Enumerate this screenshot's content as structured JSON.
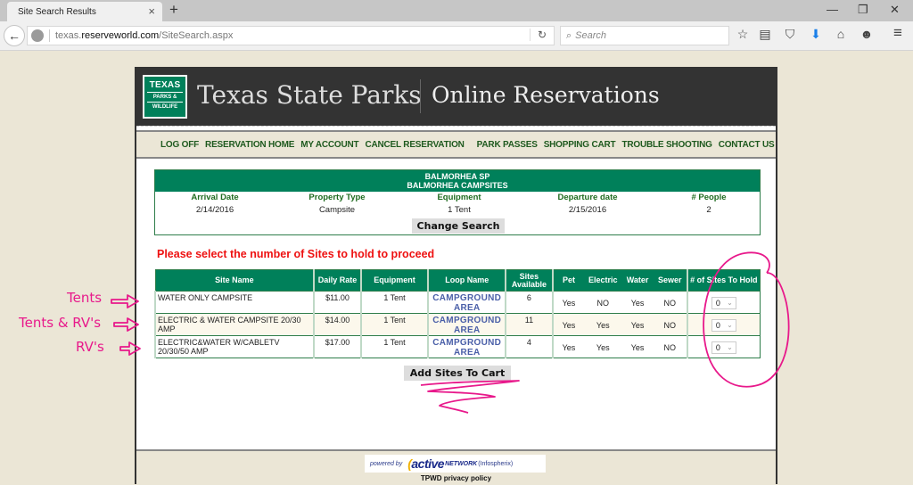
{
  "browser": {
    "tab_title": "Site Search Results",
    "tab_close": "×",
    "new_tab": "+",
    "url_prefix": "texas.",
    "url_host": "reserveworld.com",
    "url_path": "/SiteSearch.aspx",
    "search_placeholder": "Search",
    "window_controls": {
      "minimize": "—",
      "restore": "❐",
      "close": "✕"
    },
    "toolbar_icons": [
      "star-icon",
      "reading-list-icon",
      "pocket-icon",
      "download-icon",
      "home-icon",
      "hello-icon",
      "menu-icon"
    ],
    "icons": {
      "back": "←",
      "reload": "↻",
      "search": "🔍",
      "star": "☆",
      "reading_list": "▤",
      "pocket": "⛉",
      "download": "⬇",
      "home": "⌂",
      "hello": "☻",
      "menu": "≡"
    },
    "download_color": "#1a7fe8"
  },
  "header": {
    "logo": {
      "line1": "TEXAS",
      "line2": "PARKS &",
      "line3": "WILDLIFE"
    },
    "title": "Texas State Parks",
    "subtitle": "Online Reservations",
    "brand_color": "#00805a"
  },
  "menu": {
    "items": [
      "LOG OFF",
      "RESERVATION HOME",
      "MY ACCOUNT",
      "CANCEL RESERVATION",
      "PARK PASSES",
      "SHOPPING CART",
      "TROUBLE SHOOTING",
      "CONTACT US"
    ]
  },
  "summary": {
    "park": "BALMORHEA SP",
    "area": "BALMORHEA CAMPSITES",
    "fields": [
      {
        "label": "Arrival Date",
        "value": "2/14/2016"
      },
      {
        "label": "Property Type",
        "value": "Campsite"
      },
      {
        "label": "Equipment",
        "value": "1 Tent"
      },
      {
        "label": "Departure date",
        "value": "2/15/2016"
      },
      {
        "label": "# People",
        "value": "2"
      }
    ],
    "change_button": "Change Search"
  },
  "prompt": "Please select the number of Sites to hold to proceed",
  "sites_table": {
    "headers": [
      "Site Name",
      "Daily Rate",
      "Equipment",
      "Loop Name",
      "Sites Available",
      "Pet",
      "Electric",
      "Water",
      "Sewer",
      "# of Sites To Hold"
    ],
    "rows": [
      {
        "site_name": "WATER ONLY CAMPSITE",
        "rate": "$11.00",
        "equipment": "1 Tent",
        "loop": "CAMPGROUND AREA",
        "available": "6",
        "pet": "Yes",
        "electric": "NO",
        "water": "Yes",
        "sewer": "NO",
        "hold": "0"
      },
      {
        "site_name": "ELECTRIC & WATER CAMPSITE 20/30 AMP",
        "rate": "$14.00",
        "equipment": "1 Tent",
        "loop": "CAMPGROUND AREA",
        "available": "11",
        "pet": "Yes",
        "electric": "Yes",
        "water": "Yes",
        "sewer": "NO",
        "hold": "0"
      },
      {
        "site_name": "ELECTRIC&WATER W/CABLETV 20/30/50 AMP",
        "rate": "$17.00",
        "equipment": "1 Tent",
        "loop": "CAMPGROUND AREA",
        "available": "4",
        "pet": "Yes",
        "electric": "Yes",
        "water": "Yes",
        "sewer": "NO",
        "hold": "0"
      }
    ]
  },
  "add_button": "Add Sites To Cart",
  "footer": {
    "powered_by": "powered by",
    "active": "active",
    "network": "NETWORK",
    "infospherix": "(Infospherix)",
    "privacy": "TPWD privacy policy"
  },
  "annotations": {
    "labels": [
      "Tents",
      "Tents & RV's",
      "RV's"
    ],
    "color": "#e8198b"
  }
}
